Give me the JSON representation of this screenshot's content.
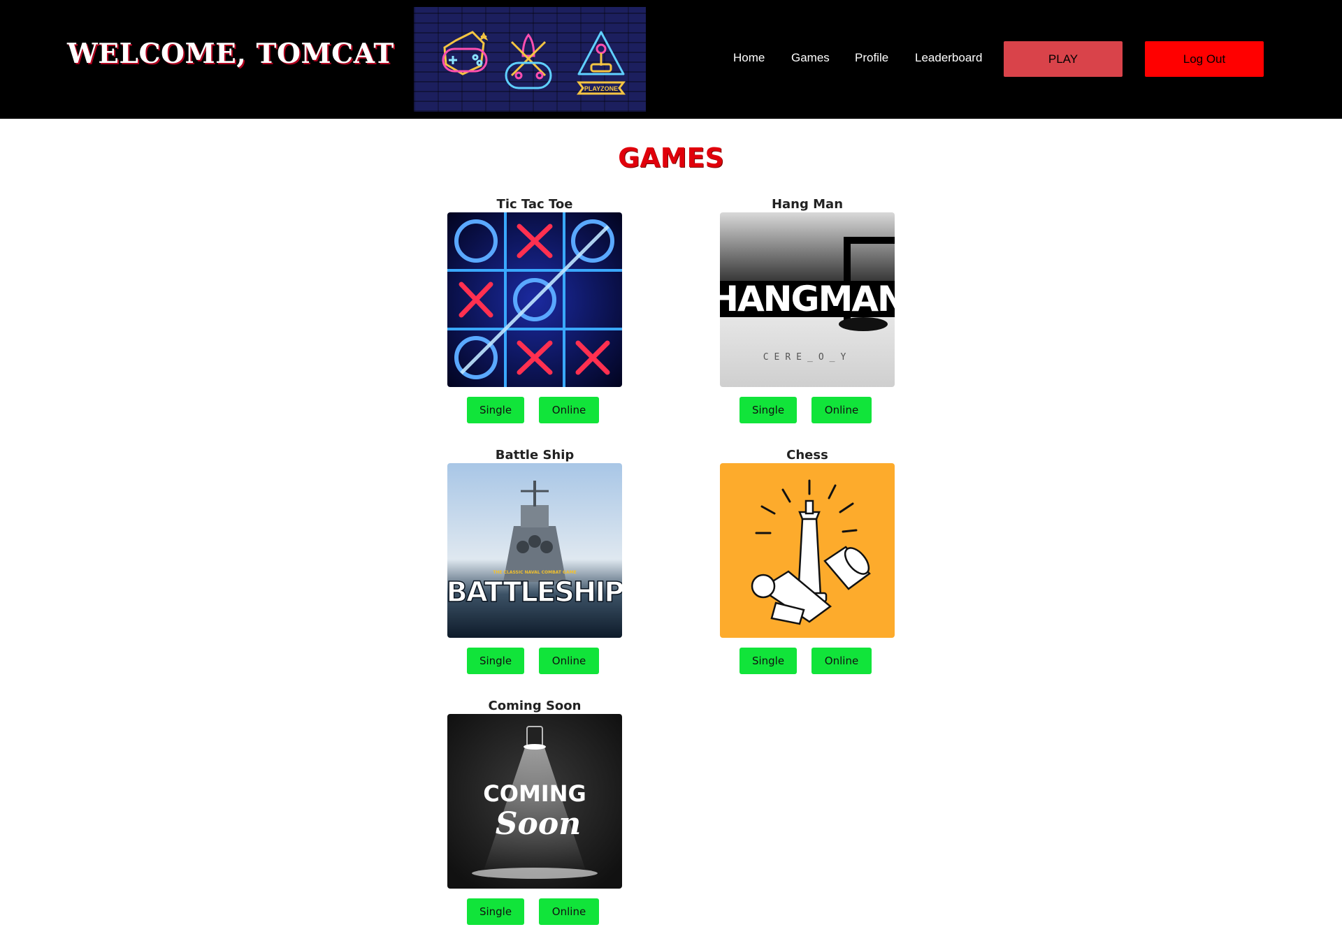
{
  "header": {
    "welcome": "WELCOME, TOMCAT",
    "banner_label": "PLAYZONE",
    "nav": [
      "Home",
      "Games",
      "Profile",
      "Leaderboard"
    ],
    "play_label": "PLAY",
    "logout_label": "Log Out"
  },
  "page_title": "GAMES",
  "games": [
    {
      "title": "Tic Tac Toe",
      "single": "Single",
      "online": "Online"
    },
    {
      "title": "Hang Man",
      "image_text": "HANGMAN",
      "image_puzzle": "CERE_O_Y",
      "single": "Single",
      "online": "Online"
    },
    {
      "title": "Battle Ship",
      "image_text": "BATTLESHIP",
      "image_tagline": "THE CLASSIC NAVAL COMBAT GAME",
      "single": "Single",
      "online": "Online"
    },
    {
      "title": "Chess",
      "single": "Single",
      "online": "Online"
    },
    {
      "title": "Coming Soon",
      "image_text_1": "COMING",
      "image_text_2": "Soon",
      "single": "Single",
      "online": "Online"
    }
  ],
  "colors": {
    "header_bg": "#000000",
    "play_button": "#d9434a",
    "logout_button": "#ff0000",
    "title_red": "#e0000b",
    "game_button": "#11e43a",
    "chess_bg": "#fdab2c"
  }
}
